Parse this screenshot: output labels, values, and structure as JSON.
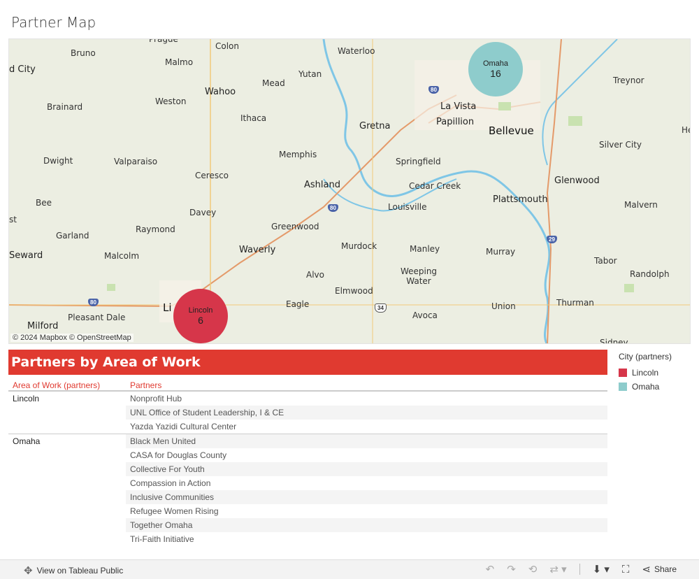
{
  "page": {
    "title": "Partner Map"
  },
  "map": {
    "attribution": "© 2024 Mapbox  © OpenStreetMap",
    "places": {
      "prague": "Prague",
      "colon": "Colon",
      "waterloo": "Waterloo",
      "bruno": "Bruno",
      "malmo": "Malmo",
      "david_city": "d City",
      "yutan": "Yutan",
      "mead": "Mead",
      "wahoo": "Wahoo",
      "weston": "Weston",
      "brainard": "Brainard",
      "ithaca": "Ithaca",
      "la_vista": "La Vista",
      "papillion": "Papillion",
      "bellevue": "Bellevue",
      "gretna": "Gretna",
      "treynor": "Treynor",
      "he": "He",
      "silver_city": "Silver City",
      "memphis": "Memphis",
      "springfield": "Springfield",
      "dwight": "Dwight",
      "valparaiso": "Valparaiso",
      "ceresco": "Ceresco",
      "glenwood": "Glenwood",
      "ashland": "Ashland",
      "cedar_creek": "Cedar Creek",
      "plattsmouth": "Plattsmouth",
      "louisville": "Louisville",
      "bee": "Bee",
      "malvern": "Malvern",
      "davey": "Davey",
      "st": "st",
      "greenwood": "Greenwood",
      "raymond": "Raymond",
      "garland": "Garland",
      "murdock": "Murdock",
      "manley": "Manley",
      "murray": "Murray",
      "waverly": "Waverly",
      "seward": "Seward",
      "malcolm": "Malcolm",
      "tabor": "Tabor",
      "weeping_water": "Weeping Water",
      "alvo": "Alvo",
      "randolph": "Randolph",
      "elmwood": "Elmwood",
      "thurman": "Thurman",
      "eagle": "Eagle",
      "union": "Union",
      "li": "Li",
      "milford": "Milford",
      "pleasant_dale": "Pleasant Dale",
      "avoca": "Avoca",
      "sidney": "Sidney"
    },
    "shields": {
      "i80a": "80",
      "i80b": "80",
      "i80c": "80",
      "i29": "29",
      "us34": "34"
    },
    "bubbles": [
      {
        "city": "Omaha",
        "count": "16",
        "color": "#8ecccc"
      },
      {
        "city": "Lincoln",
        "count": "6",
        "color": "#d6364a"
      }
    ]
  },
  "table": {
    "header": "Partners by Area of Work",
    "col_area": "Area of Work (partners)",
    "col_partners": "Partners",
    "groups": [
      {
        "name": "Lincoln",
        "partners": [
          "Nonprofit Hub",
          "UNL Office of Student Leadership, I & CE",
          "Yazda Yazidi Cultural Center"
        ]
      },
      {
        "name": "Omaha",
        "partners": [
          "Black Men United",
          "CASA for Douglas County",
          "Collective For Youth",
          "Compassion in Action",
          "Inclusive Communities",
          "Refugee Women Rising",
          "Together Omaha",
          "Tri-Faith Initiative"
        ]
      }
    ]
  },
  "legend": {
    "title": "City (partners)",
    "items": [
      {
        "label": "Lincoln",
        "color": "#d6364a"
      },
      {
        "label": "Omaha",
        "color": "#8ecccc"
      }
    ]
  },
  "toolbar": {
    "view_label": "View on Tableau Public",
    "share_label": "Share",
    "icons": [
      "tableau-icon",
      "undo-icon",
      "redo-icon",
      "revert-icon",
      "refresh-icon",
      "download-icon",
      "fullscreen-icon",
      "share-icon"
    ]
  },
  "colors": {
    "header": "#e03a30",
    "omaha": "#8ecccc",
    "lincoln": "#d6364a"
  }
}
